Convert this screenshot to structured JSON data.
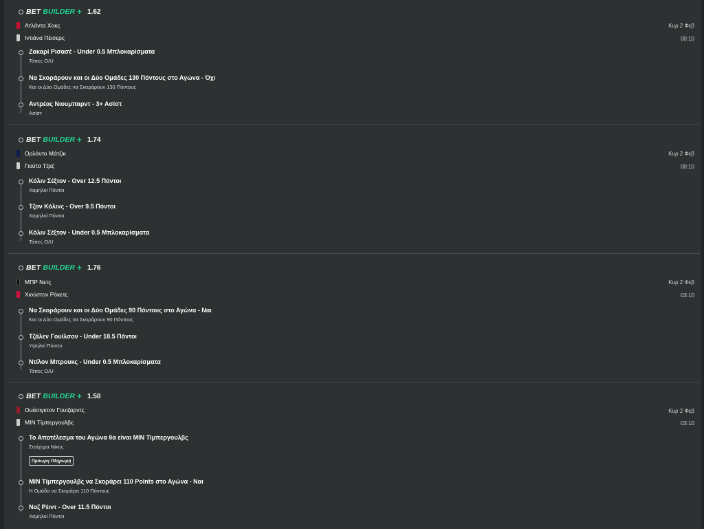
{
  "cards": [
    {
      "bet_label": "BET",
      "builder_label": "BUILDER",
      "plus": "+",
      "odds": "1.62",
      "team1": "Ατλάντα Χοκς",
      "team1_color": "#c8102e",
      "team2": "Ιντιάνα Πέισερς",
      "team2_color": "#d0d0d0",
      "date": "Κυρ 2 Φεβ",
      "time": "00:10",
      "selections": [
        {
          "title": "Ζακαρί Ρισασέ - Under 0.5 Μπλοκαρίσματα",
          "sub": "Τάπες O/U"
        },
        {
          "title": "Να Σκοράρουν και οι Δύο Ομάδες 130 Πόντους στο Αγώνα - Όχι",
          "sub": "Και οι Δύο Ομάδες να Σκοράρουν 130 Πόντους"
        },
        {
          "title": "Αντρέας Νιουμπαρντ - 3+ Ασίστ",
          "sub": "Ασίστ"
        }
      ]
    },
    {
      "bet_label": "BET",
      "builder_label": "BUILDER",
      "plus": "+",
      "odds": "1.74",
      "team1": "Ορλάντο Μάτζικ",
      "team1_color": "#0b1d4a",
      "team2": "Γιούτα Τζαζ",
      "team2_color": "#d0d0d0",
      "date": "Κυρ 2 Φεβ",
      "time": "00:10",
      "selections": [
        {
          "title": "Κόλιν Σέξτον - Over 12.5 Πόντοι",
          "sub": "Χαμηλοί Πόντοι"
        },
        {
          "title": "Τζον Κόλινς - Over 9.5 Πόντοι",
          "sub": "Χαμηλοί Πόντοι"
        },
        {
          "title": "Κόλιν Σέξτον - Under 0.5 Μπλοκαρίσματα",
          "sub": "Τάπες O/U"
        }
      ]
    },
    {
      "bet_label": "BET",
      "builder_label": "BUILDER",
      "plus": "+",
      "odds": "1.76",
      "team1": "ΜΠΡ Νετς",
      "team1_color": "#111111",
      "team2": "Χιούστον Ρόκετς",
      "team2_color": "#ce1141",
      "date": "Κυρ 2 Φεβ",
      "time": "03:10",
      "selections": [
        {
          "title": "Να Σκοράρουν και οι Δύο Ομάδες 90 Πόντους στο Αγώνα - Ναι",
          "sub": "Και οι Δύο Ομάδες να Σκοράρουν 90 Πόντους"
        },
        {
          "title": "Τζάλεν Γουίλσον - Under 18.5 Πόντοι",
          "sub": "Υψηλοί Πόντοι"
        },
        {
          "title": "Ντίλον Μπρουκς - Under 0.5 Μπλοκαρίσματα",
          "sub": "Τάπες O/U"
        }
      ]
    },
    {
      "bet_label": "BET",
      "builder_label": "BUILDER",
      "plus": "+",
      "odds": "1.50",
      "team1": "Ουάσιγκτον Γουίζαρντς",
      "team1_color": "#9b1c2c",
      "team2": "ΜΙΝ Τίμπεργουλβς",
      "team2_color": "#d0d0d0",
      "date": "Κυρ 2 Φεβ",
      "time": "03:10",
      "badge": "Πρόωρη Πληρωμή",
      "selections": [
        {
          "title": "Το Αποτέλεσμα του Αγώνα θα είναι ΜΙΝ Τίμπεργουλβς",
          "sub": "Στοίχημα Νίκης"
        },
        {
          "title": "ΜΙΝ Τίμπεργουλβς να Σκοράρει 110 Points στο Αγώνα - Ναι",
          "sub": "Η Ομάδα να Σκοράρει 110 Πόντους"
        },
        {
          "title": "Ναζ Ρέιντ - Over 11.5 Πόντοι",
          "sub": "Χαμηλοί Πόντοι"
        }
      ]
    }
  ]
}
